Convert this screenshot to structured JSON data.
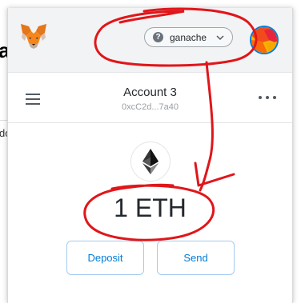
{
  "background": {
    "fragment_a": "a",
    "fragment_b": "do"
  },
  "header": {
    "logo_icon": "metamask-fox-icon",
    "network": {
      "label": "ganache",
      "status_icon": "question-circle-icon",
      "chevron_icon": "chevron-down-icon"
    },
    "avatar_icon": "account-identicon"
  },
  "account": {
    "menu_icon": "hamburger-icon",
    "name": "Account 3",
    "address": "0xcC2d...7a40",
    "options_icon": "kebab-menu-icon"
  },
  "wallet": {
    "token_icon": "ethereum-icon",
    "balance": "1 ETH",
    "deposit_label": "Deposit",
    "send_label": "Send"
  },
  "colors": {
    "accent": "#037dd6",
    "button_border": "#a5cbef",
    "annotation": "#e0161a",
    "header_bg": "#f2f3f4"
  }
}
